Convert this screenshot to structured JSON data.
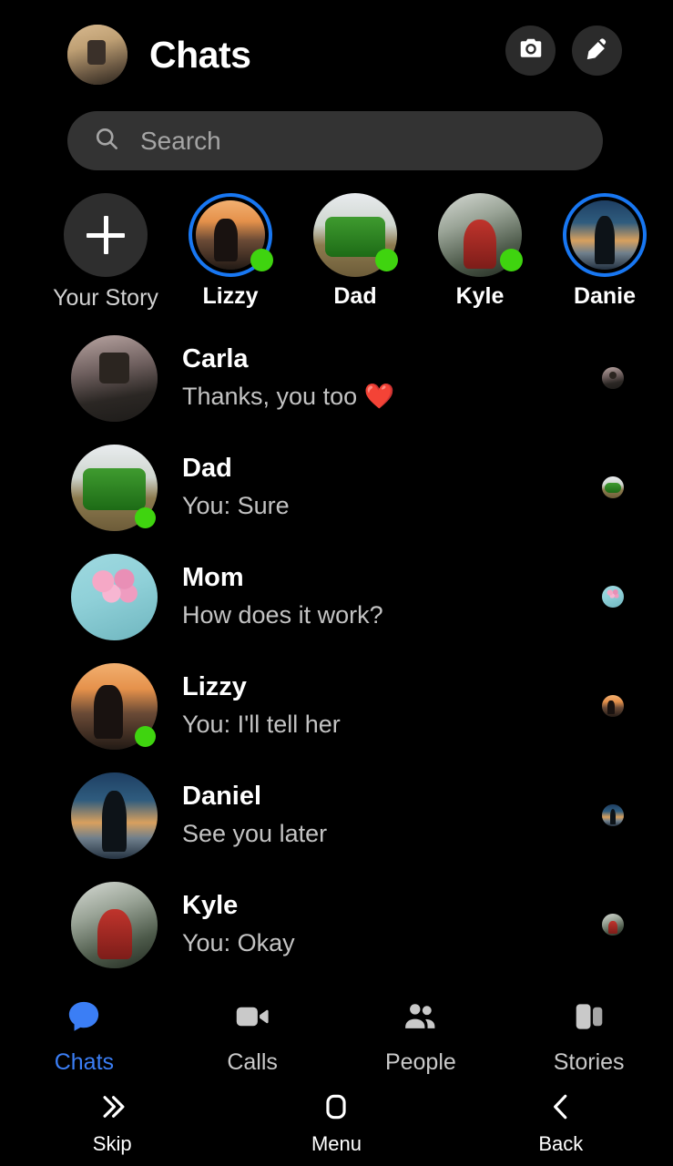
{
  "header": {
    "title": "Chats",
    "avatar_name": "me-avatar",
    "camera_icon": "camera-icon",
    "compose_icon": "pencil-compose-icon"
  },
  "search": {
    "placeholder": "Search",
    "icon": "search-icon"
  },
  "stories": {
    "your_story_label": "Your Story",
    "add_icon": "plus-icon",
    "items": [
      {
        "label": "Lizzy",
        "art": "art-lizzy",
        "ring": true,
        "online": true
      },
      {
        "label": "Dad",
        "art": "art-dad",
        "ring": false,
        "online": true
      },
      {
        "label": "Kyle",
        "art": "art-kyle",
        "ring": false,
        "online": true
      },
      {
        "label": "Danie",
        "art": "art-daniel",
        "ring": true,
        "online": false
      }
    ]
  },
  "chats": [
    {
      "name": "Carla",
      "snippet": "Thanks, you too ❤️",
      "art": "art-carla",
      "online": false,
      "receipt": "art-carla"
    },
    {
      "name": "Dad",
      "snippet": "You: Sure",
      "art": "art-dad",
      "online": true,
      "receipt": "art-dad"
    },
    {
      "name": "Mom",
      "snippet": "How does it work?",
      "art": "art-mom",
      "online": false,
      "receipt": "art-mom"
    },
    {
      "name": "Lizzy",
      "snippet": "You: I'll tell her",
      "art": "art-lizzy",
      "online": true,
      "receipt": "art-lizzy"
    },
    {
      "name": "Daniel",
      "snippet": "See you later",
      "art": "art-daniel",
      "online": false,
      "receipt": "art-daniel"
    },
    {
      "name": "Kyle",
      "snippet": "You: Okay",
      "art": "art-kyle",
      "online": false,
      "receipt": "art-kyle"
    }
  ],
  "tabbar": {
    "active": "Chats",
    "active_color": "#3b7ef5",
    "items": [
      {
        "label": "Chats",
        "icon": "chat-bubble-icon"
      },
      {
        "label": "Calls",
        "icon": "video-camera-icon"
      },
      {
        "label": "People",
        "icon": "people-icon"
      },
      {
        "label": "Stories",
        "icon": "stories-cards-icon"
      }
    ]
  },
  "sysnav": {
    "items": [
      {
        "label": "Skip",
        "icon": "double-chevron-right-icon"
      },
      {
        "label": "Menu",
        "icon": "rounded-square-icon"
      },
      {
        "label": "Back",
        "icon": "chevron-left-icon"
      }
    ]
  },
  "colors": {
    "background": "#000000",
    "search_bg": "#333333",
    "story_ring": "#1877f2",
    "presence_green": "#3fd40f",
    "accent_blue": "#3b7ef5"
  }
}
